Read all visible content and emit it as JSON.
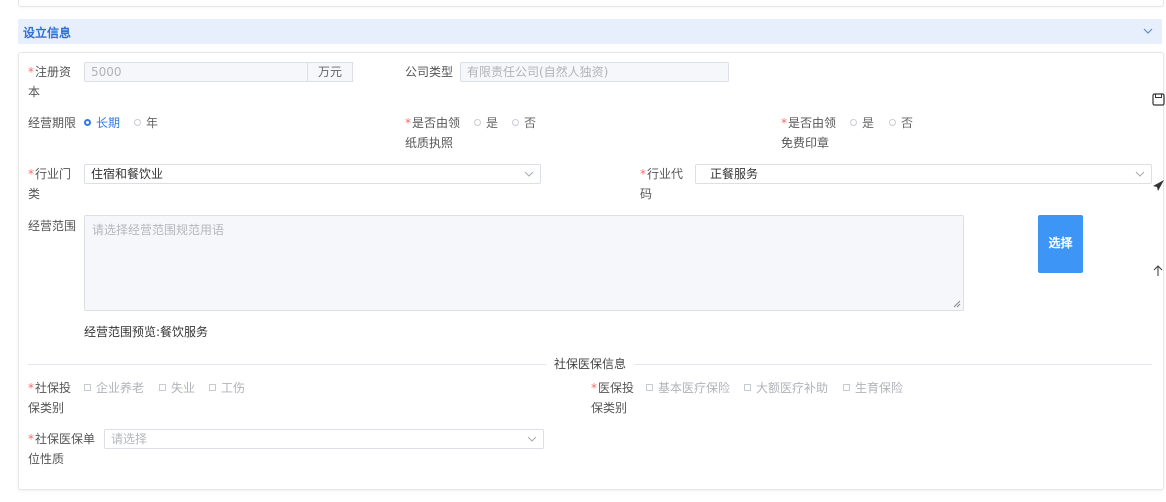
{
  "section": {
    "title": "设立信息"
  },
  "registered_capital": {
    "label_line1": "注册资",
    "label_line2": "本",
    "value": "5000",
    "unit": "万元"
  },
  "company_type": {
    "label": "公司类型",
    "placeholder": "有限责任公司(自然人独资)"
  },
  "operating_period": {
    "label": "经营期限",
    "options": [
      "长期",
      "年"
    ],
    "selected": "长期"
  },
  "paper_license": {
    "label_line1": "是否由领",
    "label_line2": "纸质执照",
    "options": [
      "是",
      "否"
    ]
  },
  "free_seal": {
    "label_line1": "是否由领",
    "label_line2": "免费印章",
    "options": [
      "是",
      "否"
    ]
  },
  "industry_category": {
    "label_line1": "行业门",
    "label_line2": "类",
    "value": "住宿和餐饮业"
  },
  "industry_code": {
    "label_line1": "行业代",
    "label_line2": "码",
    "value": "正餐服务"
  },
  "business_scope": {
    "label": "经营范围",
    "placeholder": "请选择经营范围规范用语",
    "select_button": "选择",
    "preview_label": "经营范围预览:",
    "preview_value": "餐饮服务"
  },
  "social_insurance": {
    "divider_title": "社保医保信息",
    "pension_label_line1": "社保投",
    "pension_label_line2": "保类别",
    "pension_options": [
      "企业养老",
      "失业",
      "工伤"
    ],
    "medical_label_line1": "医保投",
    "medical_label_line2": "保类别",
    "medical_options": [
      "基本医疗保险",
      "大额医疗补助",
      "生育保险"
    ],
    "unit_nature_label_line1": "社保医保单",
    "unit_nature_label_line2": "位性质",
    "unit_nature_placeholder": "请选择"
  },
  "side_tools": [
    "save-icon",
    "send-icon",
    "back-to-top-icon"
  ]
}
